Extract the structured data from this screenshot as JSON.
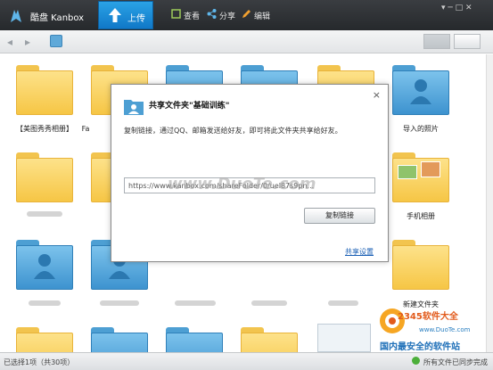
{
  "titlebar": {
    "app_title": "酷盘 Kanbox",
    "upload_label": "上传",
    "view_label": "查看",
    "share_label": "分享",
    "edit_label": "编辑",
    "window_controls": "▾  ─  □  ✕"
  },
  "nav": {
    "back": "◂",
    "forward": "▸"
  },
  "folders": {
    "labels": [
      "【美图秀秀相册】",
      "Fa",
      "导入的照片",
      "手机相册",
      "新建文件夹"
    ]
  },
  "dialog": {
    "close": "×",
    "title": "共享文件夹\"基础训练\"",
    "description": "复制链接，通过QQ、邮箱发送给好友，即可将此文件夹共享给好友。",
    "url": "https://www.kanbox.com/shareFolder/0/uel87s9pn...",
    "copy_button": "复制链接",
    "share_settings": "共享设置"
  },
  "watermark": {
    "text": "www.DuoTe.com",
    "badge_site": "2345软件大全",
    "badge_url": "www.DuoTe.com",
    "badge_slogan": "国内最安全的软件站"
  },
  "status": {
    "left": "已选择1项（共30项）",
    "right": "所有文件已同步完成"
  },
  "colors": {
    "accent": "#1a87d6",
    "toolbar": "#2f3236",
    "folder_yellow": "#f6c645",
    "folder_blue": "#3d93cf",
    "link": "#1a5fb4"
  }
}
